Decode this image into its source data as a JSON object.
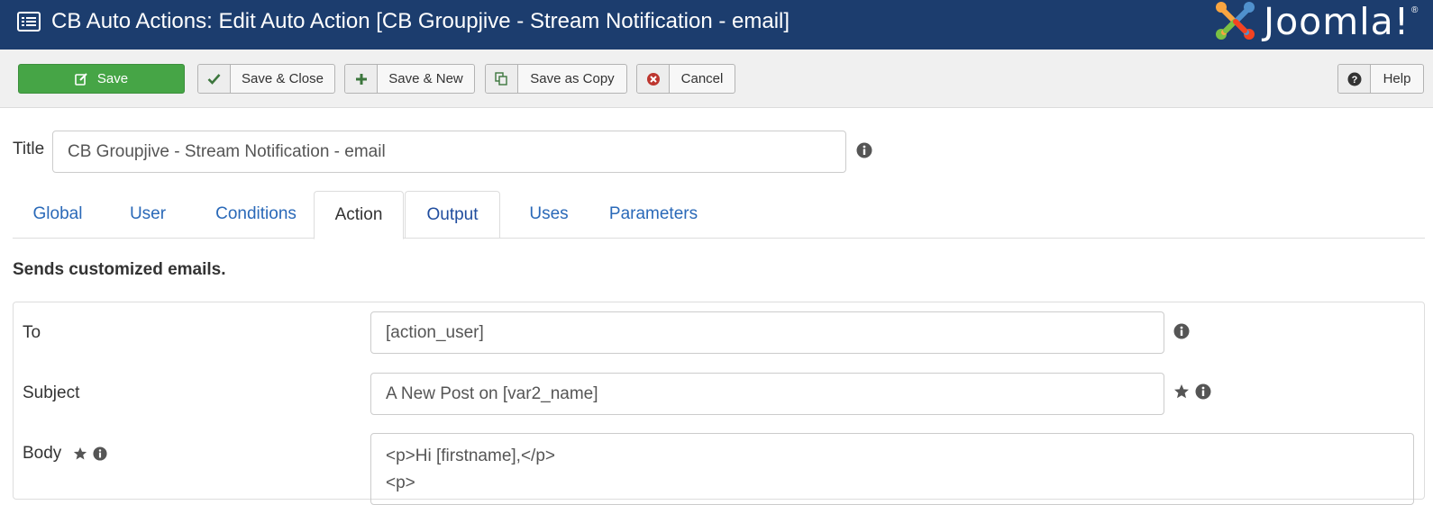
{
  "header": {
    "title": "CB Auto Actions: Edit Auto Action [CB Groupjive - Stream Notification - email]",
    "logo_text": "Joomla!",
    "logo_mark": "®"
  },
  "toolbar": {
    "save_label": "Save",
    "save_close_label": "Save & Close",
    "save_new_label": "Save & New",
    "save_copy_label": "Save as Copy",
    "cancel_label": "Cancel",
    "help_label": "Help"
  },
  "title_field": {
    "label": "Title",
    "value": "CB Groupjive - Stream Notification - email"
  },
  "tabs": [
    {
      "label": "Global"
    },
    {
      "label": "User"
    },
    {
      "label": "Conditions"
    },
    {
      "label": "Action"
    },
    {
      "label": "Output"
    },
    {
      "label": "Uses"
    },
    {
      "label": "Parameters"
    }
  ],
  "active_tab": "Action",
  "description": "Sends customized emails.",
  "fields": {
    "to": {
      "label": "To",
      "value": "[action_user]"
    },
    "subject": {
      "label": "Subject",
      "value": "A New Post on [var2_name]"
    },
    "body": {
      "label": "Body",
      "value": "<p>Hi [firstname],</p>\n<p>"
    }
  },
  "colors": {
    "header_bg": "#1c3d6e",
    "save_green": "#46a546",
    "link_blue": "#2a69b8",
    "cancel_red": "#bd362f"
  }
}
